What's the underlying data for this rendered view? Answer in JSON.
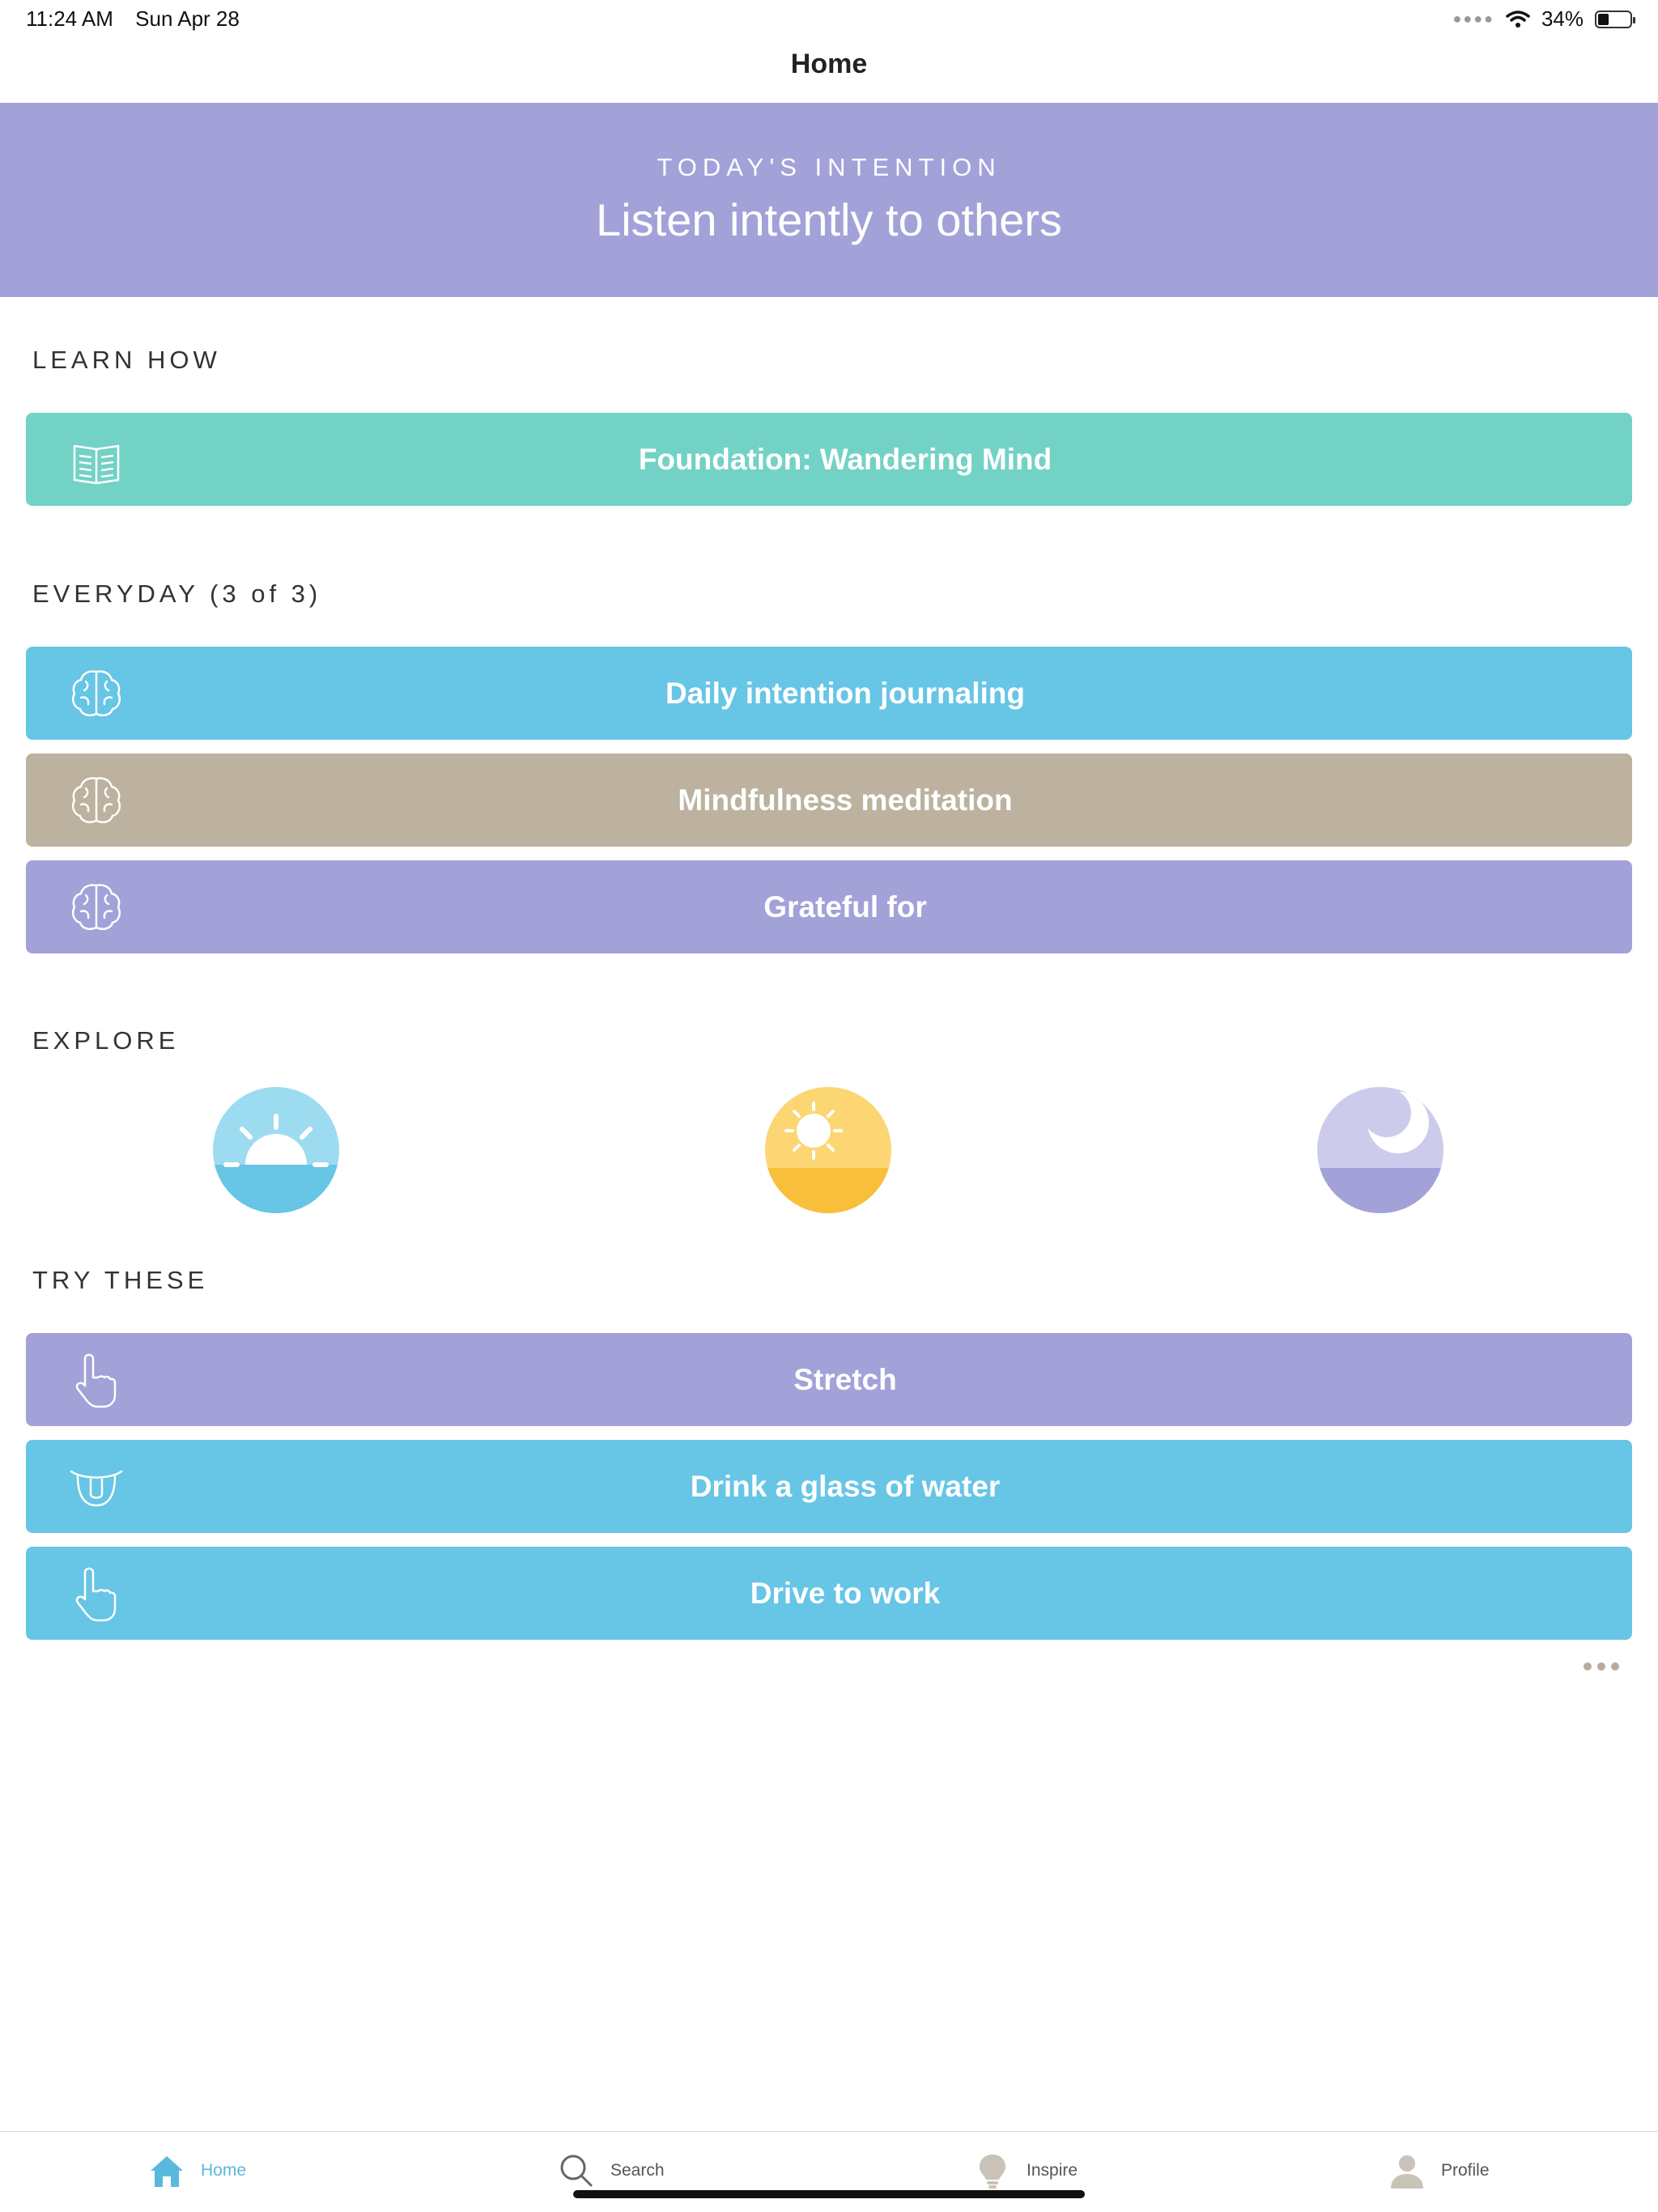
{
  "status": {
    "time": "11:24 AM",
    "date": "Sun Apr 28",
    "battery": "34%",
    "battery_level": 0.34
  },
  "nav": {
    "title": "Home"
  },
  "intention": {
    "kicker": "TODAY'S INTENTION",
    "text": "Listen intently to others"
  },
  "learn": {
    "heading": "LEARN HOW",
    "items": [
      {
        "label": "Foundation: Wandering Mind",
        "icon": "book-icon",
        "color": "#72d2c5"
      }
    ]
  },
  "everyday": {
    "heading": "EVERYDAY (3 of 3)",
    "items": [
      {
        "label": "Daily intention journaling",
        "icon": "brain-icon",
        "color": "#67c5e6"
      },
      {
        "label": "Mindfulness meditation",
        "icon": "brain-icon",
        "color": "#bcb29f"
      },
      {
        "label": "Grateful for",
        "icon": "brain-icon",
        "color": "#a2a1d8"
      }
    ]
  },
  "explore": {
    "heading": "EXPLORE",
    "items": [
      {
        "icon": "sunrise-icon",
        "top_color": "#9ddcf0",
        "bottom_color": "#67c5e6"
      },
      {
        "icon": "sun-icon",
        "top_color": "#fbd673",
        "bottom_color": "#f8c03a"
      },
      {
        "icon": "moon-icon",
        "top_color": "#cdcbeb",
        "bottom_color": "#a2a1d8"
      }
    ]
  },
  "try_these": {
    "heading": "TRY THESE",
    "items": [
      {
        "label": "Stretch",
        "icon": "pointing-hand-icon",
        "color": "#a2a1d8"
      },
      {
        "label": "Drink a glass of water",
        "icon": "glass-icon",
        "color": "#67c5e6"
      },
      {
        "label": "Drive to work",
        "icon": "pointing-hand-icon",
        "color": "#67c5e6"
      }
    ]
  },
  "tabs": [
    {
      "label": "Home",
      "icon": "home-icon",
      "active": true
    },
    {
      "label": "Search",
      "icon": "search-icon",
      "active": false
    },
    {
      "label": "Inspire",
      "icon": "lightbulb-icon",
      "active": false
    },
    {
      "label": "Profile",
      "icon": "profile-icon",
      "active": false
    }
  ],
  "colors": {
    "accent_purple": "#a2a1d8",
    "accent_blue": "#67c5e6",
    "accent_teal": "#72d2c5",
    "accent_taupe": "#bcb29f",
    "tab_active": "#5bb8dd"
  }
}
